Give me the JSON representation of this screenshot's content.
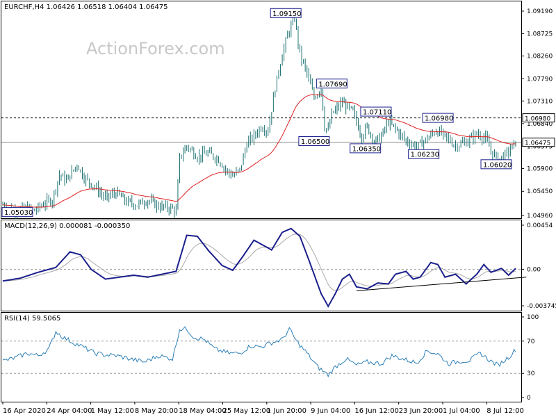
{
  "header": {
    "title": "EURCHF,H4  1.06426 1.06518 1.06404 1.06475",
    "watermark": "ActionForex.com"
  },
  "colors": {
    "candle": "#1a6f70",
    "ma": "#e02020",
    "macd": "#1a1f8c",
    "signal": "#aaaaaa",
    "rsi": "#2c7fb8",
    "grid": "#999999"
  },
  "chart_data": [
    {
      "type": "candlestick",
      "title": "EURCHF,H4  1.06426 1.06518 1.06404 1.06475",
      "ylim": [
        1.0496,
        1.0919
      ],
      "yticks": [
        1.0919,
        1.08725,
        1.0826,
        1.0779,
        1.0733,
        1.0686,
        1.06395,
        1.0593,
        1.0546,
        1.0496
      ],
      "ytick_labels": [
        "1.09190",
        "1.08725",
        "1.08260",
        "1.07790",
        "1.07310",
        "1.06840",
        "1.06375",
        "1.05900",
        "1.05450",
        "1.04960"
      ],
      "x_labels": [
        "16 Apr 2020",
        "24 Apr 04:00",
        "1 May 12:00",
        "8 May 20:00",
        "18 May 04:00",
        "25 May 12:00",
        "1 Jun 20:00",
        "9 Jun 04:00",
        "16 Jun 12:00",
        "23 Jun 20:00",
        "1 Jul 04:00",
        "8 Jul 12:00"
      ],
      "last_price": 1.06475,
      "last_price_label": "1.06475",
      "resistance_level": 1.0698,
      "resistance_label": "1.06980",
      "annotations": [
        {
          "label": "1.09150",
          "index": 160,
          "value": 1.0915
        },
        {
          "label": "1.07690",
          "index": 186,
          "value": 1.0769
        },
        {
          "label": "1.07110",
          "index": 211,
          "value": 1.0711
        },
        {
          "label": "1.06980",
          "index": 246,
          "value": 1.0698
        },
        {
          "label": "1.06500",
          "index": 176,
          "value": 1.065
        },
        {
          "label": "1.06350",
          "index": 205,
          "value": 1.0635
        },
        {
          "label": "1.06230",
          "index": 238,
          "value": 1.0623
        },
        {
          "label": "1.06020",
          "index": 279,
          "value": 1.0602
        },
        {
          "label": "1.05030",
          "index": 1,
          "value": 1.0503
        }
      ],
      "ma_period_note": "",
      "keypoints": [
        [
          0,
          1.0518
        ],
        [
          6,
          1.0507
        ],
        [
          12,
          1.0511
        ],
        [
          18,
          1.0506
        ],
        [
          24,
          1.0522
        ],
        [
          28,
          1.0528
        ],
        [
          32,
          1.058
        ],
        [
          36,
          1.0568
        ],
        [
          42,
          1.0602
        ],
        [
          46,
          1.0575
        ],
        [
          52,
          1.0555
        ],
        [
          58,
          1.0532
        ],
        [
          64,
          1.0543
        ],
        [
          70,
          1.0524
        ],
        [
          76,
          1.0518
        ],
        [
          82,
          1.0528
        ],
        [
          88,
          1.0515
        ],
        [
          95,
          1.0511
        ],
        [
          98,
          1.0505
        ],
        [
          100,
          1.0615
        ],
        [
          104,
          1.064
        ],
        [
          110,
          1.0618
        ],
        [
          116,
          1.0625
        ],
        [
          122,
          1.0612
        ],
        [
          126,
          1.059
        ],
        [
          130,
          1.0578
        ],
        [
          134,
          1.059
        ],
        [
          138,
          1.0645
        ],
        [
          142,
          1.066
        ],
        [
          146,
          1.068
        ],
        [
          150,
          1.0672
        ],
        [
          154,
          1.076
        ],
        [
          158,
          1.083
        ],
        [
          162,
          1.088
        ],
        [
          165,
          1.0905
        ],
        [
          168,
          1.083
        ],
        [
          172,
          1.079
        ],
        [
          176,
          1.074
        ],
        [
          180,
          1.076
        ],
        [
          182,
          1.068
        ],
        [
          184,
          1.0672
        ],
        [
          186,
          1.0705
        ],
        [
          192,
          1.073
        ],
        [
          198,
          1.071
        ],
        [
          203,
          1.066
        ],
        [
          206,
          1.068
        ],
        [
          210,
          1.0648
        ],
        [
          214,
          1.066
        ],
        [
          218,
          1.069
        ],
        [
          222,
          1.0675
        ],
        [
          228,
          1.065
        ],
        [
          234,
          1.0638
        ],
        [
          240,
          1.0655
        ],
        [
          245,
          1.0672
        ],
        [
          250,
          1.066
        ],
        [
          256,
          1.064
        ],
        [
          262,
          1.0648
        ],
        [
          268,
          1.0665
        ],
        [
          273,
          1.0655
        ],
        [
          276,
          1.063
        ],
        [
          280,
          1.0612
        ],
        [
          284,
          1.062
        ],
        [
          290,
          1.0647
        ]
      ]
    },
    {
      "type": "line",
      "title": "MACD(12,26,9) 0.000081 -0.000350",
      "ylim": [
        -0.003745,
        0.00454
      ],
      "ytick_labels": [
        "0.00454",
        "0.00",
        "-0.003745"
      ],
      "zero_label": "0.00",
      "macd_keypoints": [
        [
          0,
          -0.0012
        ],
        [
          10,
          -0.0009
        ],
        [
          20,
          -0.0003
        ],
        [
          30,
          0.0002
        ],
        [
          38,
          0.0018
        ],
        [
          44,
          0.0015
        ],
        [
          50,
          0.0
        ],
        [
          58,
          -0.001
        ],
        [
          66,
          -0.0008
        ],
        [
          74,
          -0.0006
        ],
        [
          82,
          -0.0008
        ],
        [
          90,
          -0.0005
        ],
        [
          98,
          -0.0002
        ],
        [
          104,
          0.0035
        ],
        [
          110,
          0.0034
        ],
        [
          116,
          0.002
        ],
        [
          124,
          0.0004
        ],
        [
          130,
          -0.0001
        ],
        [
          136,
          0.0014
        ],
        [
          142,
          0.003
        ],
        [
          146,
          0.0026
        ],
        [
          152,
          0.002
        ],
        [
          158,
          0.0038
        ],
        [
          163,
          0.0042
        ],
        [
          168,
          0.0034
        ],
        [
          174,
          0.0005
        ],
        [
          180,
          -0.0025
        ],
        [
          184,
          -0.0038
        ],
        [
          188,
          -0.0025
        ],
        [
          192,
          -0.001
        ],
        [
          196,
          -0.0005
        ],
        [
          200,
          -0.0018
        ],
        [
          206,
          -0.002
        ],
        [
          212,
          -0.0014
        ],
        [
          218,
          -0.0015
        ],
        [
          222,
          -0.0005
        ],
        [
          228,
          -0.0002
        ],
        [
          232,
          -0.001
        ],
        [
          236,
          -0.0008
        ],
        [
          242,
          0.0007
        ],
        [
          246,
          0.0005
        ],
        [
          250,
          -0.0008
        ],
        [
          256,
          -0.0005
        ],
        [
          262,
          -0.0015
        ],
        [
          268,
          -0.0005
        ],
        [
          272,
          0.0005
        ],
        [
          276,
          -0.0003
        ],
        [
          282,
          0.0001
        ],
        [
          286,
          -0.0006
        ],
        [
          290,
          0.0001
        ]
      ],
      "trendline": [
        [
          200,
          -0.0022
        ],
        [
          296,
          -0.0008
        ]
      ]
    },
    {
      "type": "line",
      "title": "RSI(14) 59.5065",
      "ylim": [
        0,
        100
      ],
      "yticks": [
        100,
        70,
        30,
        0
      ],
      "ytick_labels": [
        "100",
        "70",
        "30",
        "0"
      ],
      "levels": [
        70,
        30
      ],
      "keypoints": [
        [
          0,
          45
        ],
        [
          8,
          50
        ],
        [
          14,
          55
        ],
        [
          20,
          52
        ],
        [
          26,
          60
        ],
        [
          30,
          82
        ],
        [
          34,
          75
        ],
        [
          40,
          68
        ],
        [
          46,
          62
        ],
        [
          52,
          55
        ],
        [
          58,
          53
        ],
        [
          64,
          52
        ],
        [
          72,
          48
        ],
        [
          80,
          44
        ],
        [
          88,
          52
        ],
        [
          96,
          48
        ],
        [
          100,
          85
        ],
        [
          104,
          85
        ],
        [
          108,
          75
        ],
        [
          114,
          72
        ],
        [
          120,
          60
        ],
        [
          128,
          55
        ],
        [
          134,
          55
        ],
        [
          140,
          64
        ],
        [
          146,
          63
        ],
        [
          152,
          68
        ],
        [
          158,
          72
        ],
        [
          162,
          85
        ],
        [
          166,
          70
        ],
        [
          172,
          55
        ],
        [
          178,
          38
        ],
        [
          184,
          28
        ],
        [
          188,
          38
        ],
        [
          194,
          48
        ],
        [
          200,
          40
        ],
        [
          206,
          44
        ],
        [
          214,
          42
        ],
        [
          220,
          52
        ],
        [
          226,
          48
        ],
        [
          234,
          43
        ],
        [
          240,
          58
        ],
        [
          246,
          54
        ],
        [
          252,
          42
        ],
        [
          258,
          45
        ],
        [
          264,
          46
        ],
        [
          270,
          55
        ],
        [
          276,
          45
        ],
        [
          280,
          40
        ],
        [
          286,
          50
        ],
        [
          290,
          59.5
        ]
      ]
    }
  ]
}
